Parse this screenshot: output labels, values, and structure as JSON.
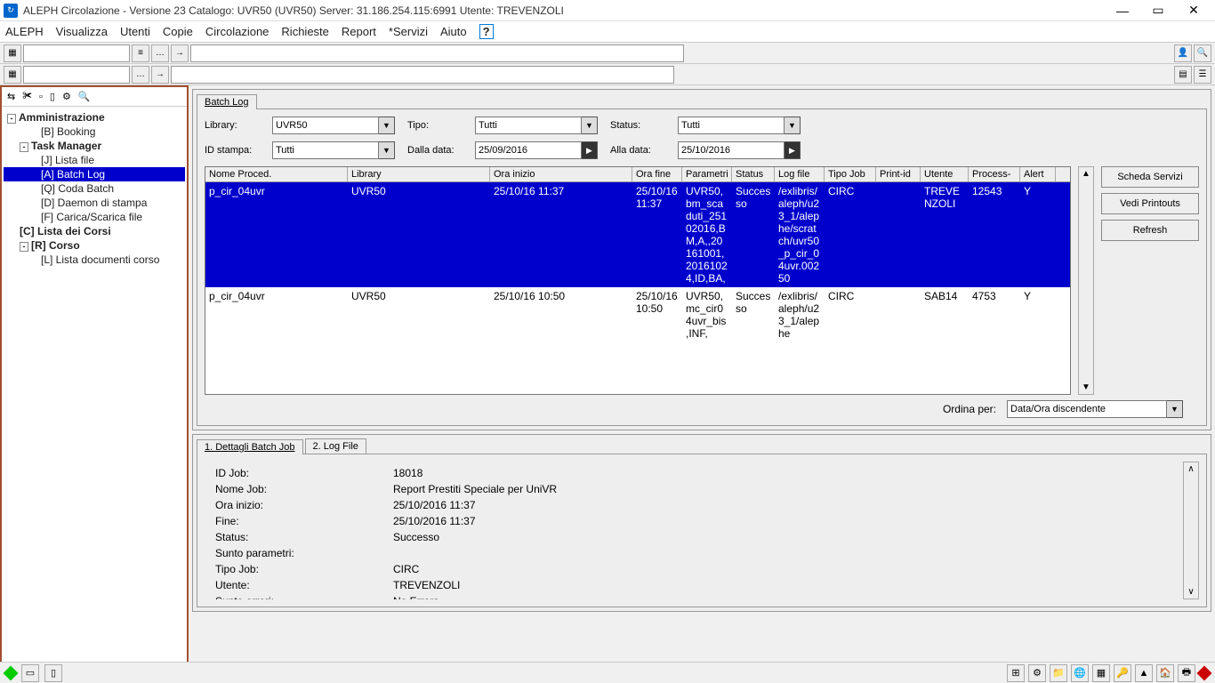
{
  "title": "ALEPH Circolazione - Versione 23  Catalogo:  UVR50 (UVR50)  Server:  31.186.254.115:6991  Utente:  TREVENZOLI",
  "menu": [
    "ALEPH",
    "Visualizza",
    "Utenti",
    "Copie",
    "Circolazione",
    "Richieste",
    "Report",
    "*Servizi",
    "Aiuto"
  ],
  "tree": {
    "root": "Amministrazione",
    "booking": "[B] Booking",
    "tm": "Task Manager",
    "tm_items": [
      "[J] Lista file",
      "[A] Batch Log",
      "[Q] Coda Batch",
      "[D] Daemon di stampa",
      "[F] Carica/Scarica file"
    ],
    "lista_corsi": "[C] Lista dei Corsi",
    "corso": "[R] Corso",
    "corso_items": [
      "[L] Lista documenti corso"
    ]
  },
  "top_tab": "Batch Log",
  "filters": {
    "library_label": "Library:",
    "library": "UVR50",
    "tipo_label": "Tipo:",
    "tipo": "Tutti",
    "status_label": "Status:",
    "status": "Tutti",
    "idstampa_label": "ID stampa:",
    "idstampa": "Tutti",
    "dalla_label": "Dalla data:",
    "dalla": "25/09/2016",
    "alla_label": "Alla data:",
    "alla": "25/10/2016"
  },
  "columns": [
    "Nome Proced.",
    "Library",
    "Ora inizio",
    "Ora fine",
    "Parametri",
    "Status",
    "Log file",
    "Tipo Job",
    "Print-id",
    "Utente",
    "Process-",
    "Alert"
  ],
  "rows": [
    {
      "proc": "p_cir_04uvr",
      "lib": "UVR50",
      "start": "25/10/16 11:37",
      "end": "25/10/16 11:37",
      "params": "UVR50,bm_scaduti_25102016,BM,A,,20161001,20161024,ID,BA,",
      "status": "Successo",
      "log": "/exlibris/aleph/u23_1/alephe/scratch/uvr50_p_cir_04uvr.00250",
      "tipo": "CIRC",
      "print": "",
      "utente": "TREVENZOLI",
      "proc_id": "12543",
      "alert": "Y",
      "selected": true
    },
    {
      "proc": "p_cir_04uvr",
      "lib": "UVR50",
      "start": "25/10/16 10:50",
      "end": "25/10/16 10:50",
      "params": "UVR50,mc_cir04uvr_bis,INF,",
      "status": "Successo",
      "log": "/exlibris/aleph/u23_1/alephe",
      "tipo": "CIRC",
      "print": "",
      "utente": "SAB14",
      "proc_id": "4753",
      "alert": "Y",
      "selected": false
    }
  ],
  "side_buttons": {
    "scheda": "Scheda Servizi",
    "printouts": "Vedi Printouts",
    "refresh": "Refresh"
  },
  "sort": {
    "label": "Ordina per:",
    "value": "Data/Ora discendente"
  },
  "bottom_tabs": [
    "1. Dettagli Batch Job",
    "2. Log File"
  ],
  "details": [
    {
      "l": "ID Job:",
      "v": "18018"
    },
    {
      "l": "Nome Job:",
      "v": "Report Prestiti Speciale per UniVR"
    },
    {
      "l": "Ora inizio:",
      "v": "25/10/2016 11:37"
    },
    {
      "l": "Fine:",
      "v": "25/10/2016 11:37"
    },
    {
      "l": "Status:",
      "v": "Successo"
    },
    {
      "l": "Sunto parametri:",
      "v": ""
    },
    {
      "l": "Tipo Job:",
      "v": "CIRC"
    },
    {
      "l": "Utente:",
      "v": "TREVENZOLI"
    },
    {
      "l": "Sunto errori:",
      "v": "No Errors"
    }
  ]
}
